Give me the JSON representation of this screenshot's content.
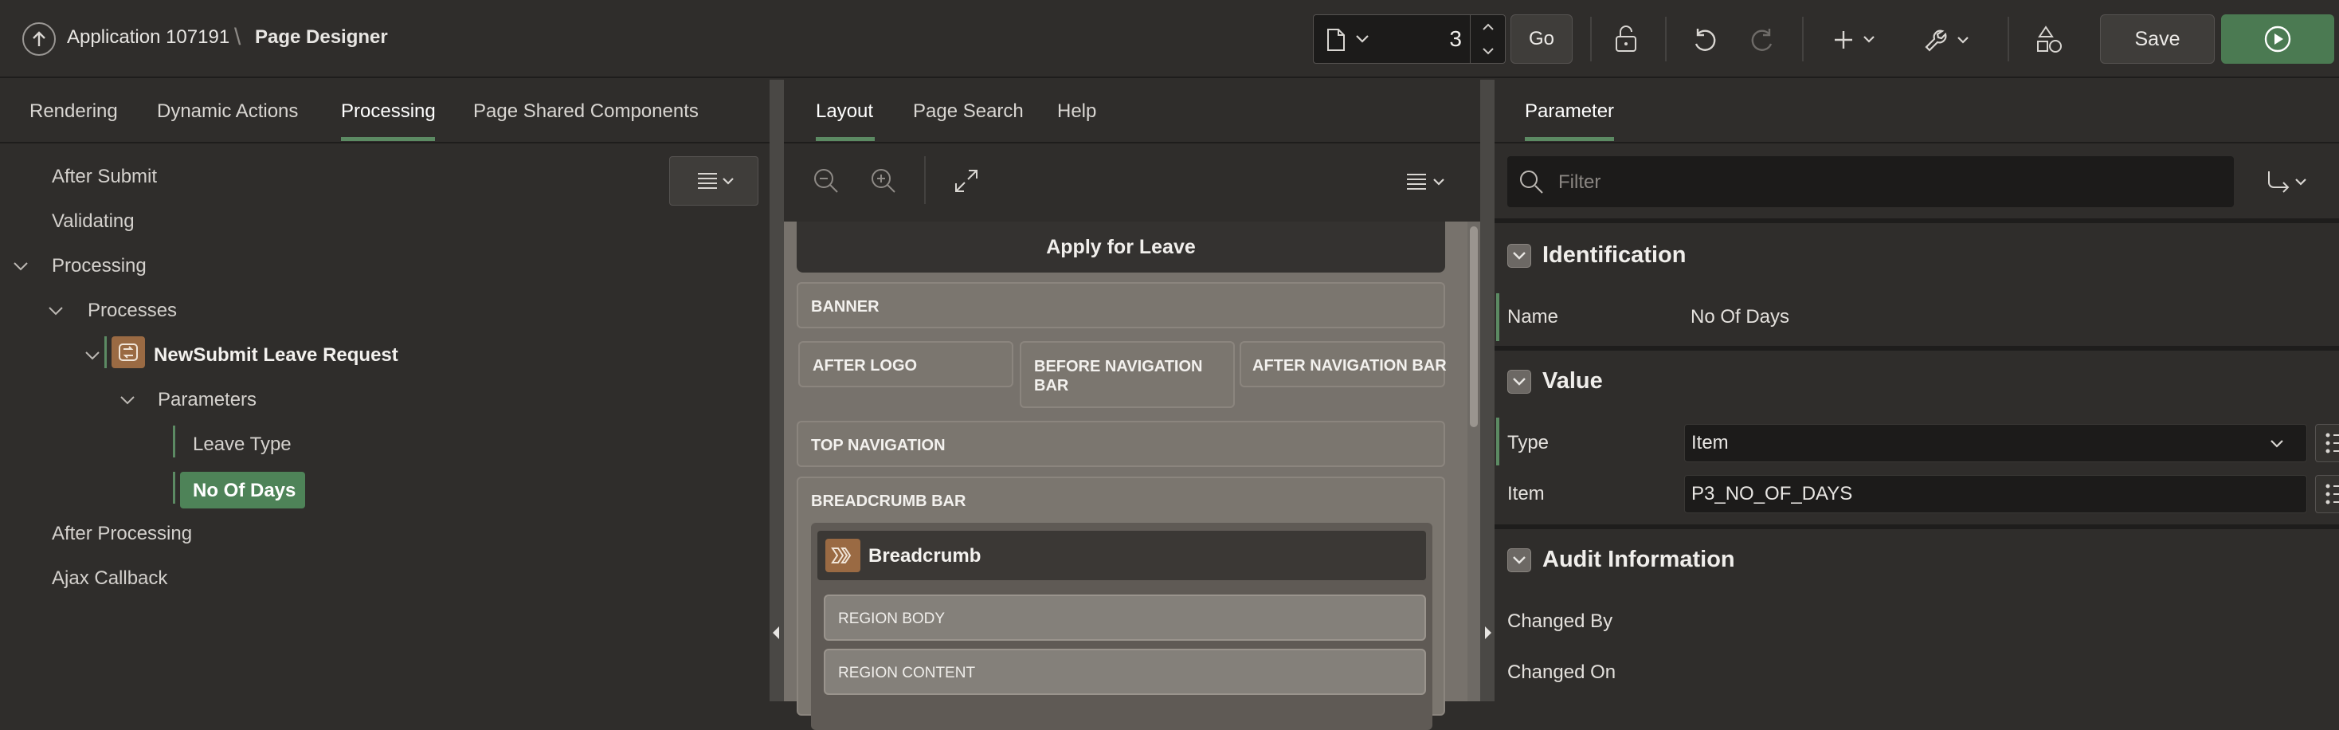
{
  "header": {
    "app_title": "Application 107191",
    "separator": "\\",
    "page_title": "Page Designer",
    "page_number": "3",
    "go_label": "Go",
    "save_label": "Save"
  },
  "left": {
    "tabs": [
      {
        "label": "Rendering"
      },
      {
        "label": "Dynamic Actions"
      },
      {
        "label": "Processing"
      },
      {
        "label": "Page Shared Components"
      }
    ],
    "tree": {
      "after_submit": "After Submit",
      "validating": "Validating",
      "processing": "Processing",
      "processes": "Processes",
      "process_item": "NewSubmit Leave Request",
      "parameters": "Parameters",
      "param_leave_type": "Leave Type",
      "param_no_of_days": "No Of Days",
      "after_processing": "After Processing",
      "ajax_callback": "Ajax Callback"
    }
  },
  "middle": {
    "tabs": [
      {
        "label": "Layout"
      },
      {
        "label": "Page Search"
      },
      {
        "label": "Help"
      }
    ],
    "canvas": {
      "page_title": "Apply for Leave",
      "banner": "BANNER",
      "after_logo": "AFTER LOGO",
      "before_nav_bar": "BEFORE NAVIGATION BAR",
      "after_nav_bar": "AFTER NAVIGATION BAR",
      "top_navigation": "TOP NAVIGATION",
      "breadcrumb_bar": "BREADCRUMB BAR",
      "breadcrumb_region": "Breadcrumb",
      "region_body": "REGION BODY",
      "region_content": "REGION CONTENT"
    }
  },
  "right": {
    "tab": "Parameter",
    "filter_placeholder": "Filter",
    "sections": {
      "identification": "Identification",
      "value": "Value",
      "audit": "Audit Information"
    },
    "fields": {
      "name_label": "Name",
      "name_value": "No Of Days",
      "type_label": "Type",
      "type_value": "Item",
      "item_label": "Item",
      "item_value": "P3_NO_OF_DAYS",
      "changed_by_label": "Changed By",
      "changed_on_label": "Changed On"
    }
  },
  "colors": {
    "accent_green": "#5c8a63",
    "run_button": "#4b7a52",
    "process_icon": "#9a6a43"
  }
}
